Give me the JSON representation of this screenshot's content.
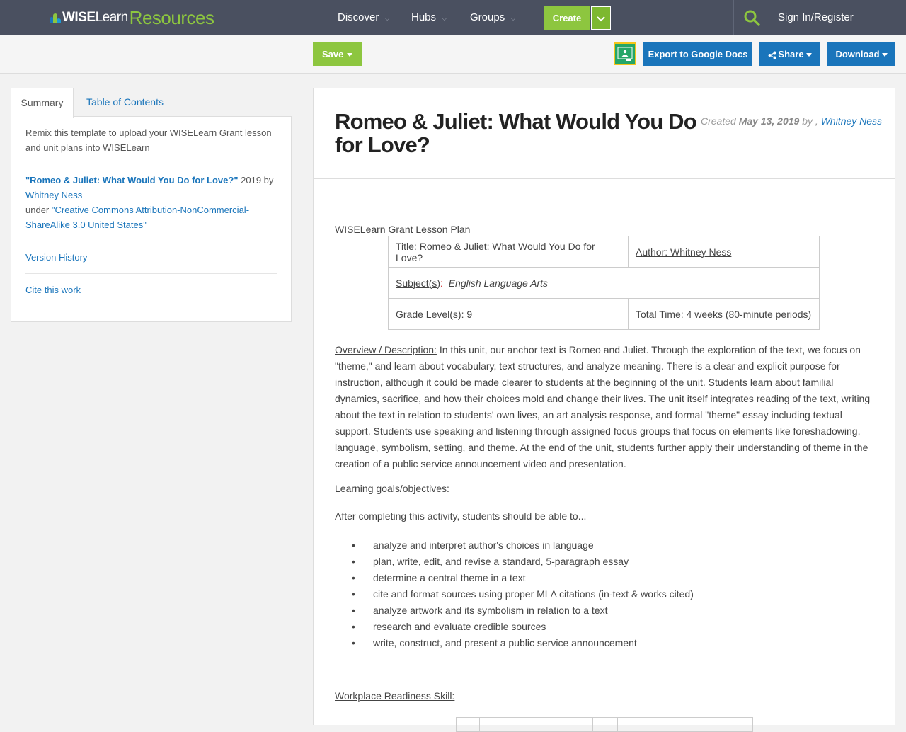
{
  "nav": {
    "logo_wise": "WISE",
    "logo_learn": "Learn",
    "logo_resources": "Resources",
    "discover": "Discover",
    "hubs": "Hubs",
    "groups": "Groups",
    "create": "Create",
    "signin": "Sign In/Register"
  },
  "toolbar": {
    "save": "Save",
    "export": "Export to Google Docs",
    "share": "Share",
    "download": "Download"
  },
  "sidebar": {
    "tab_summary": "Summary",
    "tab_toc": "Table of Contents",
    "description": "Remix this template to upload your WISELearn Grant lesson and unit plans into WISELearn",
    "attr_title": "\"Romeo & Juliet: What Would You Do for Love?\"",
    "attr_year_by": "2019 by",
    "attr_author": "Whitney Ness",
    "attr_under": "under",
    "attr_license": "\"Creative Commons Attribution-NonCommercial-ShareAlike 3.0 United States\"",
    "version_history": "Version History",
    "cite": "Cite this work"
  },
  "main": {
    "title": "Romeo & Juliet: What Would You Do for Love?",
    "created_label": "Created",
    "created_date": "May 13, 2019",
    "created_by": "by ,",
    "created_author": "Whitney Ness",
    "plan_heading": "WISELearn Grant Lesson Plan",
    "table": {
      "title_label": "Title:",
      "title_value": "Romeo & Juliet: What Would You Do for Love?",
      "author": "Author: Whitney Ness",
      "subjects_label": "Subject(s)",
      "subjects_colon": ":",
      "subjects_value": "English Language Arts",
      "grade": "Grade Level(s): 9",
      "total_time": "Total Time: 4 weeks (80-minute periods)"
    },
    "overview_label": "Overview / Description:",
    "overview_text": " In this unit, our anchor text is Romeo and Juliet. Through the exploration of the text, we focus on \"theme,\" and learn about vocabulary, text structures, and analyze meaning. There is a clear and explicit purpose for instruction, although it could be made clearer to students at the beginning of the unit. Students learn about familial dynamics, sacrifice, and how their choices mold and change their lives. The unit itself integrates reading of the text, writing about the text in relation to students' own lives, an art analysis response, and formal \"theme\" essay including textual support. Students use speaking and listening through assigned focus groups that focus on elements like foreshadowing, language, symbolism, setting, and theme. At the end of the unit, students further apply their understanding of theme in the creation of a public service announcement video and presentation.",
    "goals_heading": "Learning goals/objectives:",
    "goals_intro": "After completing this activity, students should be able to...",
    "goals": [
      "analyze and interpret author's choices in language",
      "plan, write, edit, and revise a standard, 5-paragraph essay",
      "determine a central theme in a text",
      "cite and format sources using proper MLA citations (in-text & works cited)",
      "analyze artwork and its symbolism in relation to a text",
      "research and evaluate credible sources",
      "write, construct, and present a public service announcement"
    ],
    "workplace_heading": "Workplace Readiness Skill:"
  },
  "colors": {
    "nav_bg": "#4a5060",
    "green": "#8dc63f",
    "blue": "#1a75bb"
  }
}
